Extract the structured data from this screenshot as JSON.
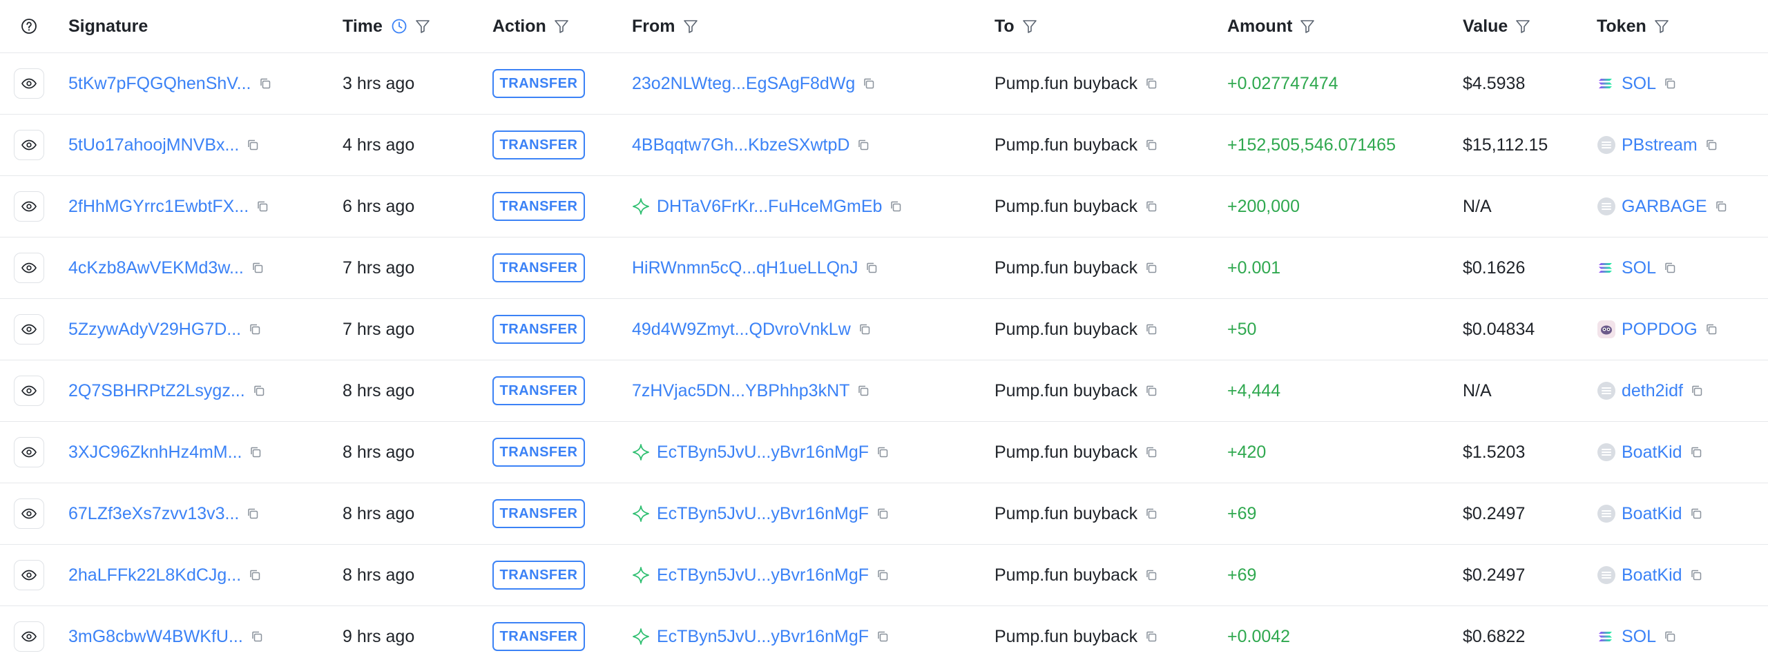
{
  "header": {
    "signature": "Signature",
    "time": "Time",
    "action": "Action",
    "from": "From",
    "to": "To",
    "amount": "Amount",
    "value": "Value",
    "token": "Token"
  },
  "colors": {
    "link": "#3b82f6",
    "amount_positive": "#2fa84f",
    "sol_gradient": [
      "#9945ff",
      "#19fb9b"
    ]
  },
  "rows": [
    {
      "signature": "5tKw7pFQGQhenShV...",
      "time": "3 hrs ago",
      "action": "TRANSFER",
      "from": "23o2NLWteg...EgSAgF8dWg",
      "from_icon": "",
      "to": "Pump.fun buyback",
      "amount": "+0.027747474",
      "value": "$4.5938",
      "token": "SOL",
      "token_icon": "sol-icon"
    },
    {
      "signature": "5tUo17ahoojMNVBx...",
      "time": "4 hrs ago",
      "action": "TRANSFER",
      "from": "4BBqqtw7Gh...KbzeSXwtpD",
      "from_icon": "",
      "to": "Pump.fun buyback",
      "amount": "+152,505,546.071465",
      "value": "$15,112.15",
      "token": "PBstream",
      "token_icon": "generic-token-icon"
    },
    {
      "signature": "2fHhMGYrrc1EwbtFX...",
      "time": "6 hrs ago",
      "action": "TRANSFER",
      "from": "DHTaV6FrKr...FuHceMGmEb",
      "from_icon": "sparkle-icon",
      "to": "Pump.fun buyback",
      "amount": "+200,000",
      "value": "N/A",
      "token": "GARBAGE",
      "token_icon": "generic-token-icon"
    },
    {
      "signature": "4cKzb8AwVEKMd3w...",
      "time": "7 hrs ago",
      "action": "TRANSFER",
      "from": "HiRWnmn5cQ...qH1ueLLQnJ",
      "from_icon": "",
      "to": "Pump.fun buyback",
      "amount": "+0.001",
      "value": "$0.1626",
      "token": "SOL",
      "token_icon": "sol-icon"
    },
    {
      "signature": "5ZzywAdyV29HG7D...",
      "time": "7 hrs ago",
      "action": "TRANSFER",
      "from": "49d4W9Zmyt...QDvroVnkLw",
      "from_icon": "",
      "to": "Pump.fun buyback",
      "amount": "+50",
      "value": "$0.04834",
      "token": "POPDOG",
      "token_icon": "popdog-icon"
    },
    {
      "signature": "2Q7SBHRPtZ2Lsygz...",
      "time": "8 hrs ago",
      "action": "TRANSFER",
      "from": "7zHVjac5DN...YBPhhp3kNT",
      "from_icon": "",
      "to": "Pump.fun buyback",
      "amount": "+4,444",
      "value": "N/A",
      "token": "deth2idf",
      "token_icon": "generic-token-icon"
    },
    {
      "signature": "3XJC96ZknhHz4mM...",
      "time": "8 hrs ago",
      "action": "TRANSFER",
      "from": "EcTByn5JvU...yBvr16nMgF",
      "from_icon": "sparkle-icon",
      "to": "Pump.fun buyback",
      "amount": "+420",
      "value": "$1.5203",
      "token": "BoatKid",
      "token_icon": "generic-token-icon"
    },
    {
      "signature": "67LZf3eXs7zvv13v3...",
      "time": "8 hrs ago",
      "action": "TRANSFER",
      "from": "EcTByn5JvU...yBvr16nMgF",
      "from_icon": "sparkle-icon",
      "to": "Pump.fun buyback",
      "amount": "+69",
      "value": "$0.2497",
      "token": "BoatKid",
      "token_icon": "generic-token-icon"
    },
    {
      "signature": "2haLFFk22L8KdCJg...",
      "time": "8 hrs ago",
      "action": "TRANSFER",
      "from": "EcTByn5JvU...yBvr16nMgF",
      "from_icon": "sparkle-icon",
      "to": "Pump.fun buyback",
      "amount": "+69",
      "value": "$0.2497",
      "token": "BoatKid",
      "token_icon": "generic-token-icon"
    },
    {
      "signature": "3mG8cbwW4BWKfU...",
      "time": "9 hrs ago",
      "action": "TRANSFER",
      "from": "EcTByn5JvU...yBvr16nMgF",
      "from_icon": "sparkle-icon",
      "to": "Pump.fun buyback",
      "amount": "+0.0042",
      "value": "$0.6822",
      "token": "SOL",
      "token_icon": "sol-icon"
    }
  ]
}
